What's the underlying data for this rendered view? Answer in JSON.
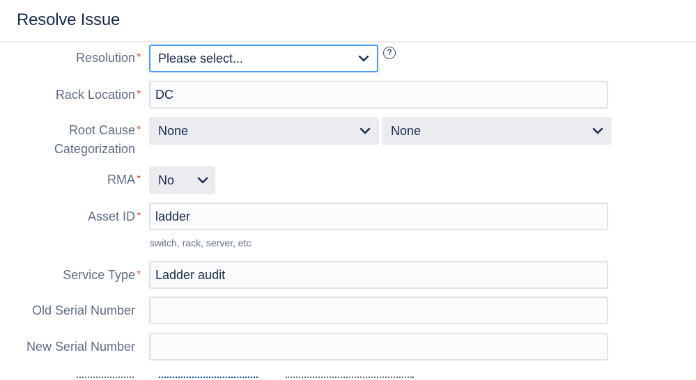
{
  "header": {
    "title": "Resolve Issue"
  },
  "form": {
    "resolution": {
      "label": "Resolution",
      "value": "Please select...",
      "help": "?"
    },
    "rack_location": {
      "label": "Rack Location",
      "value": "DC"
    },
    "root_cause": {
      "label_line1": "Root Cause",
      "label_line2": "Categorization",
      "value_primary": "None",
      "value_secondary": "None"
    },
    "rma": {
      "label": "RMA",
      "value": "No"
    },
    "asset_id": {
      "label": "Asset ID",
      "value": "ladder",
      "hint": "switch, rack, server, etc"
    },
    "service_type": {
      "label": "Service Type",
      "value": "Ladder audit"
    },
    "old_serial": {
      "label": "Old Serial Number",
      "value": ""
    },
    "new_serial": {
      "label": "New Serial Number",
      "value": ""
    },
    "required_marker": "*"
  },
  "colors": {
    "required": "#de350b",
    "focus": "#4c9aff",
    "link": "#0052cc"
  }
}
